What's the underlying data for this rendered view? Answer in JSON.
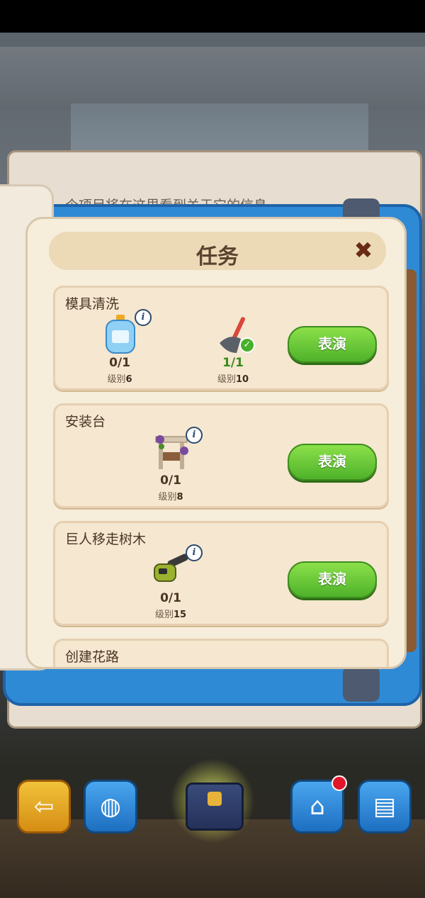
{
  "background_hint": "单击一个项目将在这里看到关于它的信息",
  "dialog": {
    "title": "任务",
    "close_icon": "close-x-icon"
  },
  "tasks": [
    {
      "title": "模具清洗",
      "requirements": [
        {
          "icon": "detergent-bottle-icon",
          "count": "0/1",
          "level_label": "级别",
          "level": "6",
          "done": false
        },
        {
          "icon": "broom-icon",
          "count": "1/1",
          "level_label": "级别",
          "level": "10",
          "done": true
        }
      ],
      "button": "表演"
    },
    {
      "title": "安装台",
      "requirements": [
        {
          "icon": "workbench-icon",
          "count": "0/1",
          "level_label": "级别",
          "level": "8",
          "done": false
        }
      ],
      "button": "表演"
    },
    {
      "title": "巨人移走树木",
      "requirements": [
        {
          "icon": "chainsaw-icon",
          "count": "0/1",
          "level_label": "级别",
          "level": "15",
          "done": false
        }
      ],
      "button": "表演"
    },
    {
      "title": "创建花路"
    }
  ],
  "toolbar": {
    "exit_icon": "exit-icon",
    "backpack_icon": "backpack-icon",
    "chest_icon": "treasure-chest-icon",
    "shop_icon": "shop-icon",
    "book_icon": "book-icon"
  },
  "colors": {
    "accent_green": "#4fb22a",
    "book_blue": "#2f8ad6",
    "notification_red": "#e0172b"
  }
}
